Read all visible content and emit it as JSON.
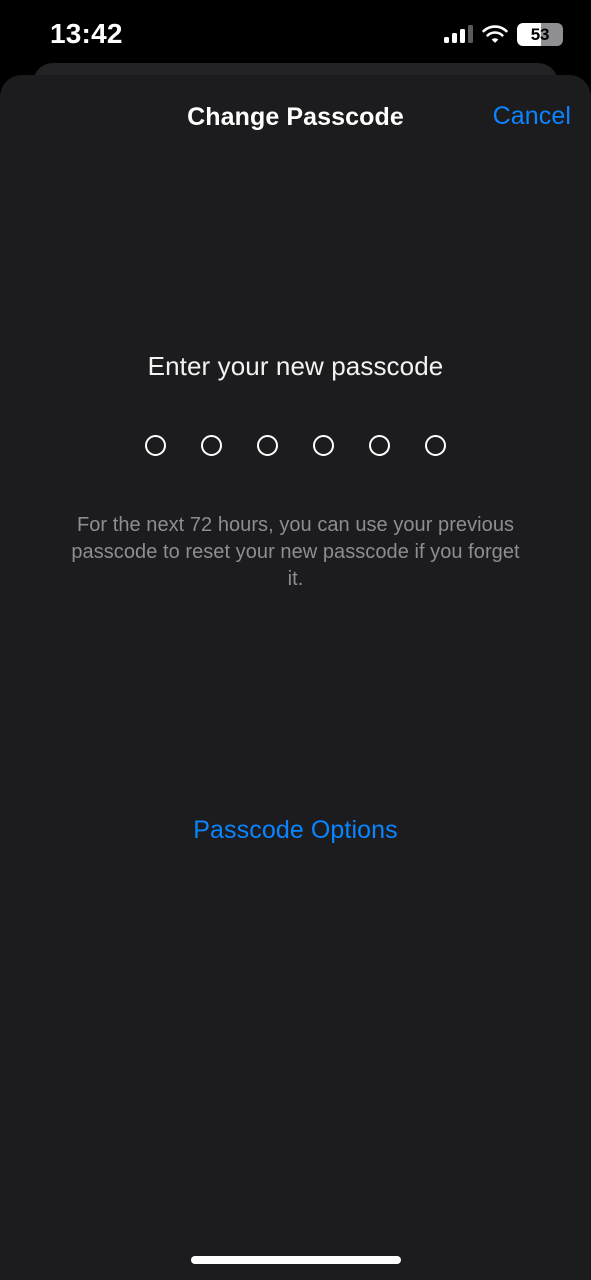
{
  "status_bar": {
    "time": "13:42",
    "cellular_icon": "cellular-bars-icon",
    "cellular_bars_active": 3,
    "cellular_bars_total": 4,
    "wifi_icon": "wifi-icon",
    "battery_icon": "battery-icon",
    "battery_percent": "53",
    "battery_level_value": 53
  },
  "sheet": {
    "title": "Change Passcode",
    "cancel_label": "Cancel"
  },
  "main": {
    "prompt": "Enter your new passcode",
    "passcode": {
      "length": 6,
      "entered": 0,
      "dots": [
        {
          "filled": false
        },
        {
          "filled": false
        },
        {
          "filled": false
        },
        {
          "filled": false
        },
        {
          "filled": false
        },
        {
          "filled": false
        }
      ]
    },
    "hint": "For the next 72 hours, you can use your previous passcode to reset your new passcode if you forget it.",
    "passcode_options_label": "Passcode Options"
  },
  "colors": {
    "accent_blue": "#0a84ff",
    "sheet_background": "#1c1c1e",
    "sheet_back_background": "#232325",
    "screen_background": "#000000",
    "hint_text": "#8d8d92"
  },
  "home_indicator": "home-indicator"
}
